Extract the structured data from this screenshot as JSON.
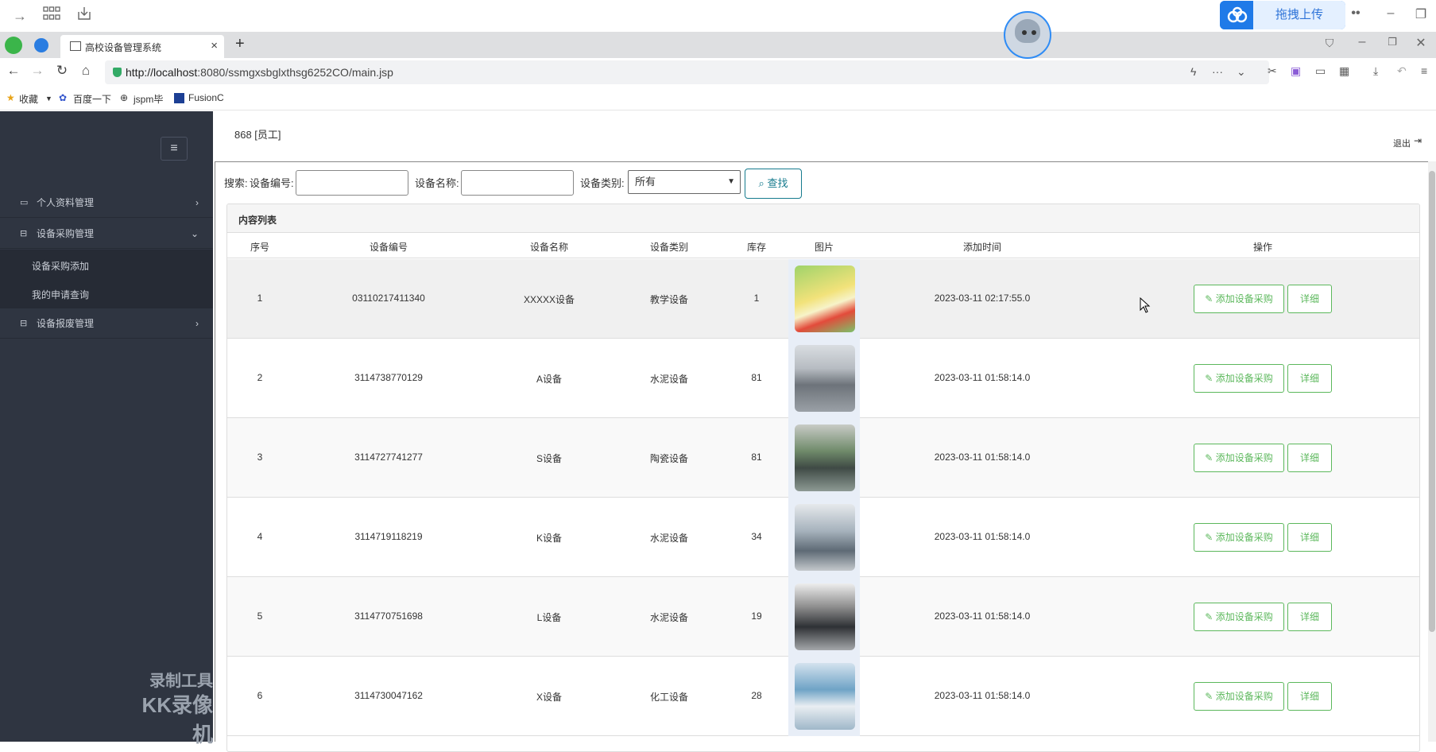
{
  "browser": {
    "tab_title": "高校设备管理系统",
    "url_host": "http://localhost",
    "url_rest": ":8080/ssmgxsbglxthsg6252CO/main.jsp",
    "upload_label": "拖拽上传",
    "bookmarks": [
      "收藏",
      "百度一下",
      "jspm毕",
      "FusionC"
    ]
  },
  "header": {
    "user_label": "868 [员工]",
    "logout_label": "退出"
  },
  "sidebar": {
    "menu": [
      {
        "label": "个人资料管理",
        "expanded": false
      },
      {
        "label": "设备采购管理",
        "expanded": true,
        "children": [
          "设备采购添加",
          "我的申请查询"
        ]
      },
      {
        "label": "设备报废管理",
        "expanded": false
      }
    ],
    "watermark_line1": "录制工具",
    "watermark_line2": "KK录像机"
  },
  "search": {
    "label_prefix": "搜索:",
    "label_code": "设备编号:",
    "label_name": "设备名称:",
    "label_type": "设备类别:",
    "type_selected": "所有",
    "button_label": "查找"
  },
  "table": {
    "panel_title": "内容列表",
    "columns": [
      "序号",
      "设备编号",
      "设备名称",
      "设备类别",
      "库存",
      "图片",
      "添加时间",
      "操作"
    ],
    "add_label": "添加设备采购",
    "detail_label": "详细",
    "rows": [
      {
        "idx": "1",
        "code": "03110217411340",
        "name": "XXXXX设备",
        "type": "教学设备",
        "stock": "1",
        "time": "2023-03-11 02:17:55.0",
        "image": "cartoon"
      },
      {
        "idx": "2",
        "code": "3114738770129",
        "name": "A设备",
        "type": "水泥设备",
        "stock": "81",
        "time": "2023-03-11 01:58:14.0",
        "image": "lab"
      },
      {
        "idx": "3",
        "code": "3114727741277",
        "name": "S设备",
        "type": "陶瓷设备",
        "stock": "81",
        "time": "2023-03-11 01:58:14.0",
        "image": "workshop"
      },
      {
        "idx": "4",
        "code": "3114719118219",
        "name": "K设备",
        "type": "水泥设备",
        "stock": "34",
        "time": "2023-03-11 01:58:14.0",
        "image": "hall"
      },
      {
        "idx": "5",
        "code": "3114770751698",
        "name": "L设备",
        "type": "水泥设备",
        "stock": "19",
        "time": "2023-03-11 01:58:14.0",
        "image": "office"
      },
      {
        "idx": "6",
        "code": "3114730047162",
        "name": "X设备",
        "type": "化工设备",
        "stock": "28",
        "time": "2023-03-11 01:58:14.0",
        "image": "lab2"
      }
    ]
  },
  "colors": {
    "sidebar_bg": "#2f3541",
    "accent_green": "#5cb85c",
    "search_btn": "#167b8e",
    "upload_blue": "#2f8cf5"
  }
}
